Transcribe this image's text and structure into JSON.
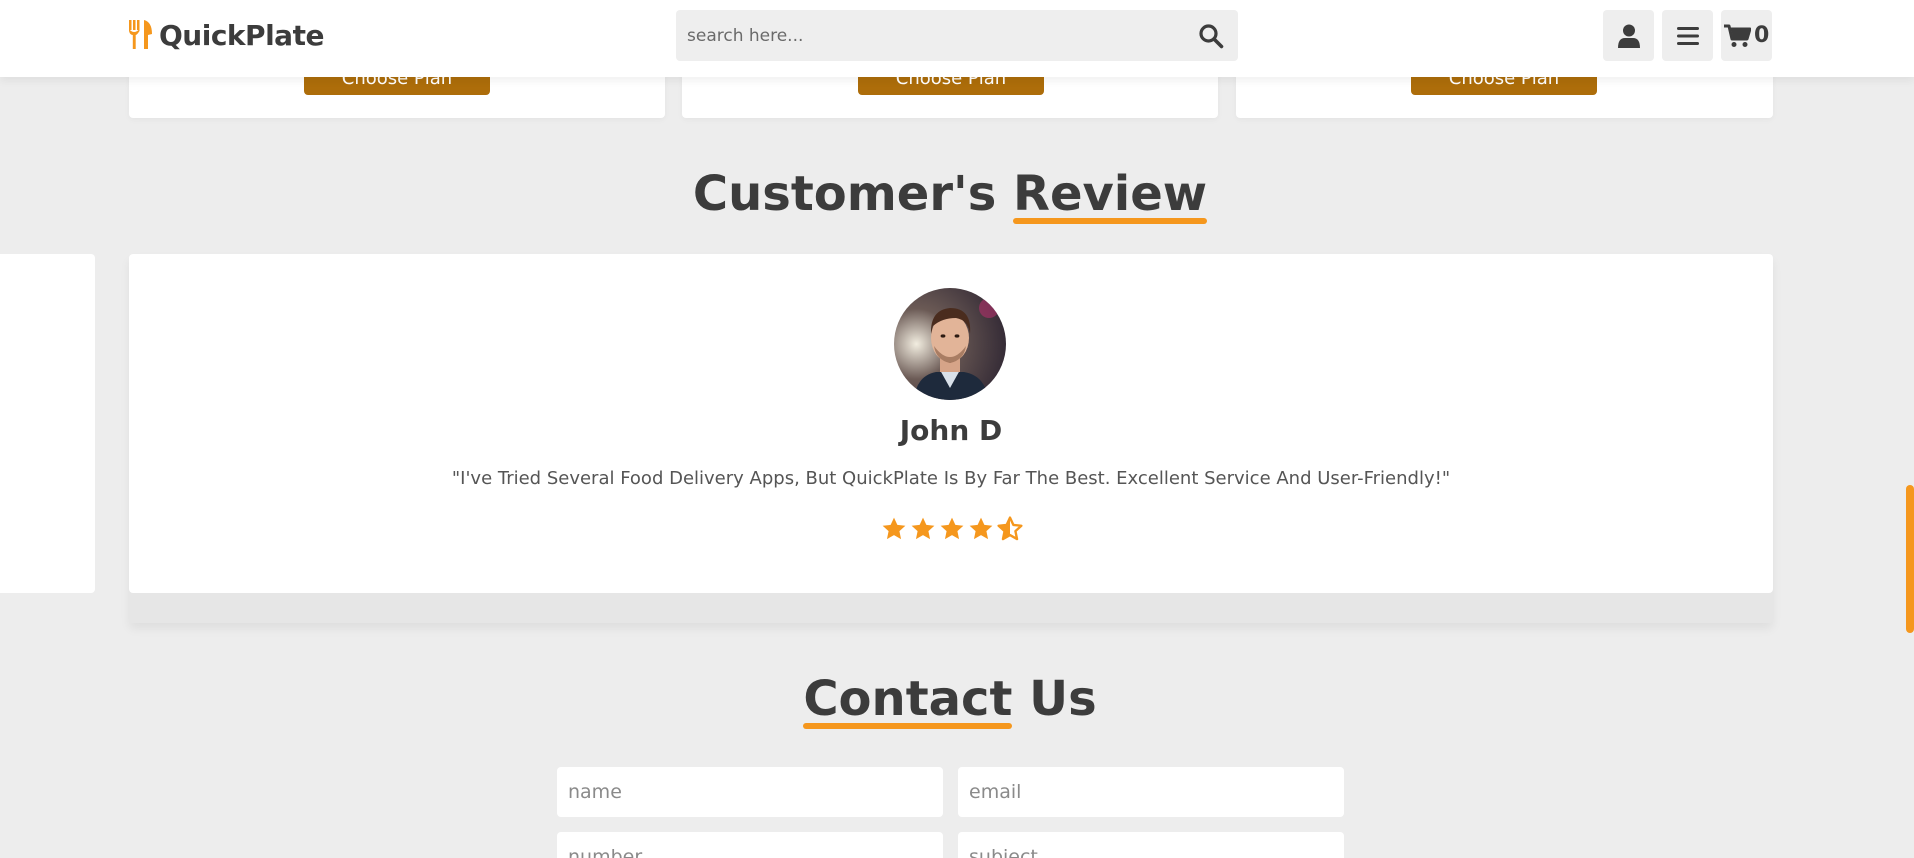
{
  "header": {
    "brand": "QuickPlate",
    "search_placeholder": "search here...",
    "cart_count": "0",
    "icons": [
      "utensils-icon",
      "search-icon",
      "user-icon",
      "menu-icon",
      "cart-icon"
    ]
  },
  "plans": {
    "button_label": "Choose Plan",
    "cards": [
      "plan-1",
      "plan-2",
      "plan-3"
    ]
  },
  "review_section": {
    "title_part1": "Customer's",
    "title_part2": "Review",
    "review": {
      "name": "John D",
      "text": "\"I've Tried Several Food Delivery Apps, But QuickPlate Is By Far The Best. Excellent Service And User-Friendly!\"",
      "rating": 4.5,
      "max_rating": 5
    }
  },
  "contact_section": {
    "title_part1": "Contact",
    "title_part2": "Us",
    "fields": {
      "name": "name",
      "email": "email",
      "number": "number",
      "subject": "subject"
    }
  },
  "colors": {
    "accent": "#f5971d",
    "button": "#ad6d0a",
    "background": "#ededed",
    "text": "#3c3c3c"
  }
}
